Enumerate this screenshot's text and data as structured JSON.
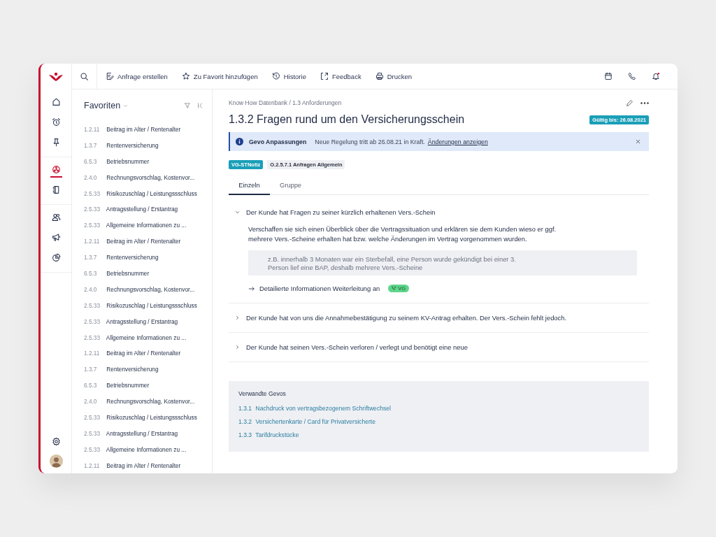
{
  "rail": {
    "groups": [
      {
        "items": [
          {
            "kind": "home",
            "selected": false
          },
          {
            "kind": "alarm",
            "selected": false
          },
          {
            "kind": "pin",
            "selected": false
          }
        ]
      },
      {
        "items": [
          {
            "kind": "network",
            "selected": true
          },
          {
            "kind": "book",
            "selected": false
          }
        ]
      },
      {
        "items": [
          {
            "kind": "users",
            "selected": false
          },
          {
            "kind": "megaphone",
            "selected": false
          },
          {
            "kind": "chart",
            "selected": false
          }
        ]
      }
    ]
  },
  "toolbar": {
    "actions": [
      {
        "kind": "request",
        "label": "Anfrage erstellen"
      },
      {
        "kind": "favorite",
        "label": "Zu Favorit hinzufügen"
      },
      {
        "kind": "history",
        "label": "Historie"
      },
      {
        "kind": "feedback",
        "label": "Feedback"
      },
      {
        "kind": "print",
        "label": "Drucken"
      }
    ]
  },
  "favorites": {
    "title": "Favoriten",
    "items": [
      {
        "code": "1.2.11",
        "label": "Beitrag im Alter / Rentenalter"
      },
      {
        "code": "1.3.7",
        "label": "Rentenversicherung"
      },
      {
        "code": "6.5.3",
        "label": "Betriebsnummer"
      },
      {
        "code": "2.4.0",
        "label": "Rechnungsvorschlag, Kostenvor..."
      },
      {
        "code": "2.5.33",
        "label": "Risikozuschlag / Leistungssschluss"
      },
      {
        "code": "2.5.33",
        "label": "Antragsstellung / Erstantrag"
      },
      {
        "code": "2.5.33",
        "label": "Allgemeine Informationen zu ..."
      },
      {
        "code": "1.2.11",
        "label": "Beitrag im Alter / Rentenalter"
      },
      {
        "code": "1.3.7",
        "label": "Rentenversicherung"
      },
      {
        "code": "6.5.3",
        "label": "Betriebsnummer"
      },
      {
        "code": "2.4.0",
        "label": "Rechnungsvorschlag, Kostenvor..."
      },
      {
        "code": "2.5.33",
        "label": "Risikozuschlag / Leistungssschluss"
      },
      {
        "code": "2.5.33",
        "label": "Antragsstellung / Erstantrag"
      },
      {
        "code": "2.5.33",
        "label": "Allgemeine Informationen zu ..."
      },
      {
        "code": "1.2.11",
        "label": "Beitrag im Alter / Rentenalter"
      },
      {
        "code": "1.3.7",
        "label": "Rentenversicherung"
      },
      {
        "code": "6.5.3",
        "label": "Betriebsnummer"
      },
      {
        "code": "2.4.0",
        "label": "Rechnungsvorschlag, Kostenvor..."
      },
      {
        "code": "2.5.33",
        "label": "Risikozuschlag / Leistungssschluss"
      },
      {
        "code": "2.5.33",
        "label": "Antragsstellung / Erstantrag"
      },
      {
        "code": "2.5.33",
        "label": "Allgemeine Informationen zu ..."
      },
      {
        "code": "1.2.11",
        "label": "Beitrag im Alter / Rentenalter"
      }
    ]
  },
  "document": {
    "breadcrumb": "Know How Datenbank / 1.3 Anforderungen",
    "title": "1.3.2 Fragen rund um den Versicherungsschein",
    "validity": "Gültig bis: 26.08.2021",
    "notice": {
      "title": "Gevo Anpassungen",
      "text": "Neue Regelung tritt ab 26.08.21 in Kraft.",
      "link": "Änderungen anzeigen"
    },
    "tags": [
      {
        "kind": "accent",
        "label": "VG-STNotiz"
      },
      {
        "kind": "plain",
        "label": "O.2.5.7.1 Anfragen Allgemein"
      }
    ],
    "tabs": [
      {
        "label": "Einzeln",
        "selected": true
      },
      {
        "label": "Gruppe",
        "selected": false
      }
    ],
    "questions": [
      {
        "title": "Der Kunde hat Fragen zu seiner kürzlich erhaltenen Vers.-Schein",
        "expanded": true,
        "text": "Verschaffen sie sich einen Überblick über die Vertragssituation und erklären sie dem Kunden wieso er ggf. mehrere Vers.-Scheine erhalten hat bzw. welche Änderungen im Vertrag vorgenommen wurden.",
        "example": "z.B. innerhalb 3 Monaten war ein Sterbefall, eine Person wurde gekündigt bei einer 3. Person lief eine BAP, deshalb mehrere Vers.-Scheine",
        "forward": {
          "text": "Detailierte Informationen Weiterleitung an",
          "badge": "VG"
        }
      },
      {
        "title": "Der Kunde hat von uns die Annahmebestätigung zu seinem KV-Antrag erhalten. Der Vers.-Schein fehlt jedoch.",
        "expanded": false
      },
      {
        "title": "Der Kunde hat seinen Vers.-Schein verloren / verlegt und benötigt eine neue",
        "expanded": false
      }
    ],
    "related": {
      "title": "Verwandte Gevos",
      "links": [
        {
          "code": "1.3.1",
          "label": "Nachdruck von vertragsbezogenem Schriftwechsel"
        },
        {
          "code": "1.3.2",
          "label": "Versichertenkarte / Card für Privatversicherte"
        },
        {
          "code": "1.3.3",
          "label": "Tarifdruckstücke"
        }
      ]
    }
  }
}
